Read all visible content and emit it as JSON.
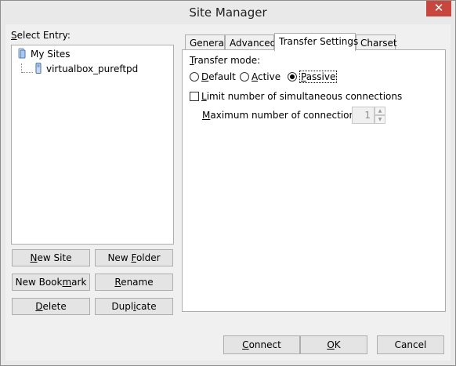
{
  "window": {
    "title": "Site Manager",
    "close_icon": "close-icon"
  },
  "select_entry": {
    "label_u": "S",
    "label_rest": "elect Entry:"
  },
  "tree": {
    "root": {
      "label": "My Sites",
      "icon": "folder-icon"
    },
    "items": [
      {
        "label": "virtualbox_pureftpd",
        "icon": "server-icon"
      }
    ]
  },
  "left_buttons": {
    "new_site": {
      "u": "N",
      "rest": "ew Site"
    },
    "new_folder": {
      "pre": "New ",
      "u": "F",
      "rest": "older"
    },
    "new_bookmark": {
      "pre": "New Book",
      "u": "m",
      "rest": "ark"
    },
    "rename": {
      "u": "R",
      "rest": "ename"
    },
    "delete": {
      "u": "D",
      "rest": "elete"
    },
    "duplicate": {
      "pre": "Dupl",
      "u": "i",
      "rest": "cate"
    }
  },
  "tabs": [
    {
      "label": "General"
    },
    {
      "label": "Advanced"
    },
    {
      "label": "Transfer Settings"
    },
    {
      "label": "Charset"
    }
  ],
  "transfer": {
    "mode_u": "T",
    "mode_rest": "ransfer mode:",
    "default": {
      "u": "D",
      "rest": "efault"
    },
    "active": {
      "u": "A",
      "rest": "ctive"
    },
    "passive": {
      "u": "P",
      "rest": "assive"
    },
    "selected_mode": "Passive",
    "limit": {
      "u": "L",
      "rest": "imit number of simultaneous connections",
      "checked": false
    },
    "max": {
      "u": "M",
      "rest": "aximum number of connections:",
      "value": "1"
    }
  },
  "footer": {
    "connect": {
      "u": "C",
      "rest": "onnect"
    },
    "ok": {
      "u": "O",
      "rest": "K"
    },
    "cancel": {
      "label": "Cancel"
    }
  }
}
